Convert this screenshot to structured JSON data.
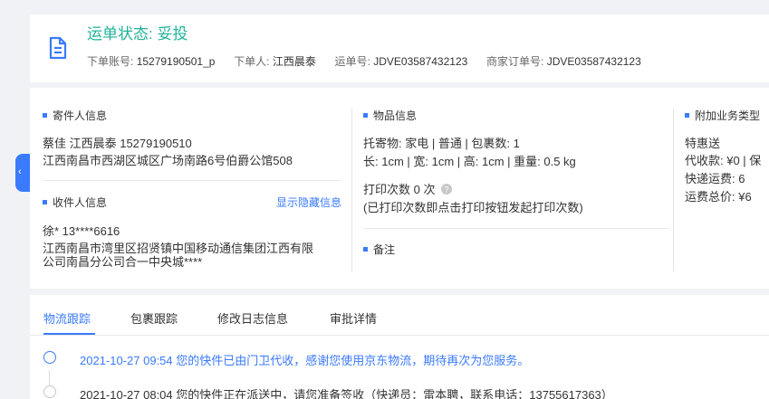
{
  "header": {
    "status_label": "运单状态: 妥投",
    "account_label": "下单账号:",
    "account_value": "15279190501_p",
    "orderer_label": "下单人:",
    "orderer_value": "江西晨泰",
    "waybill_label": "运单号:",
    "waybill_value": "JDVE03587432123",
    "merchant_order_label": "商家订单号:",
    "merchant_order_value": "JDVE03587432123"
  },
  "sender": {
    "heading": "寄件人信息",
    "name_line": "蔡佳   江西晨泰 15279190510",
    "address": "江西南昌市西湖区城区广场南路6号伯爵公馆508"
  },
  "receiver": {
    "heading": "收件人信息",
    "show_hidden": "显示隐藏信息",
    "name_line": "徐*   13****6616",
    "address_line1": "江西南昌市湾里区招贤镇中国移动通信集团江西有限",
    "address_line2": "公司南昌分公司合一中央城****"
  },
  "goods": {
    "heading": "物品信息",
    "line1": "托寄物:  家电 | 普通  |  包裹数:  1",
    "line2": "长:  1cm  |  宽:  1cm  |  高:  1cm  |  重量:  0.5 kg",
    "print_count": "打印次数   0 次",
    "print_note": "(已打印次数即点击打印按钮发起打印次数)"
  },
  "remark": {
    "heading": "备注"
  },
  "extra": {
    "heading": "附加业务类型",
    "line1": "特惠送",
    "line2": "代收款:  ¥0  |  保",
    "line3": "快递运费:  6",
    "line4": "运费总价:  ¥6"
  },
  "side_tab": {
    "glyph": "‹"
  },
  "tabs": [
    {
      "label": "物流跟踪",
      "active": true
    },
    {
      "label": "包裹跟踪",
      "active": false
    },
    {
      "label": "修改日志信息",
      "active": false
    },
    {
      "label": "审批详情",
      "active": false
    }
  ],
  "timeline": [
    {
      "text": "2021-10-27 09:54  您的快件已由门卫代收，感谢您使用京东物流，期待再次为您服务。",
      "current": true
    },
    {
      "text": "2021-10-27 08:04  您的快件正在派送中，请您准备签收（快递员：雷本聘，联系电话：13755617363）",
      "current": false
    }
  ],
  "colors": {
    "accent": "#3a7afe",
    "status": "#20b39a"
  },
  "icons": {
    "doc": "document-icon",
    "help": "question-circle-icon"
  }
}
